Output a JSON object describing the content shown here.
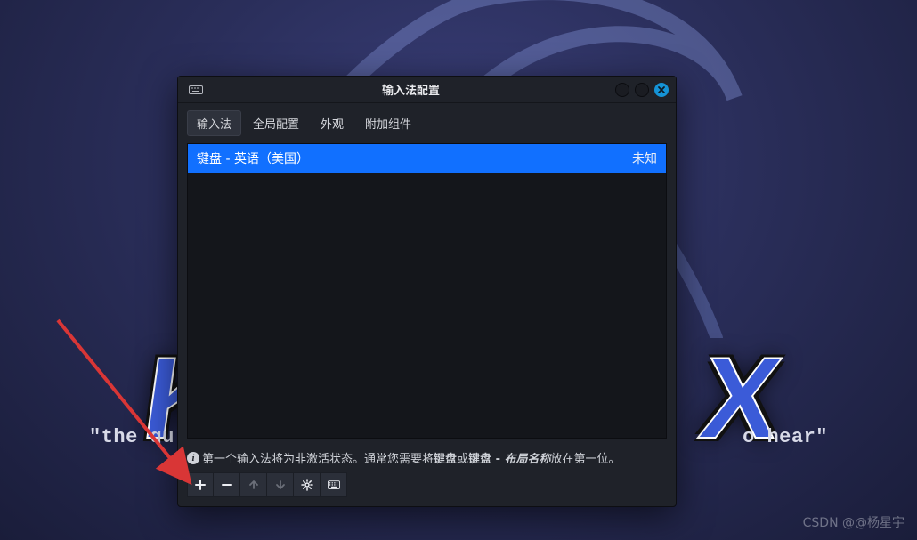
{
  "background": {
    "logo_left": "K",
    "logo_right": "X",
    "tagline_left": "\"the qu",
    "tagline_right": "o hear\""
  },
  "window": {
    "title": "输入法配置",
    "tabs": [
      {
        "label": "输入法",
        "active": true
      },
      {
        "label": "全局配置",
        "active": false
      },
      {
        "label": "外观",
        "active": false
      },
      {
        "label": "附加组件",
        "active": false
      }
    ],
    "list": {
      "selected": {
        "name": "键盘 - 英语（美国）",
        "status": "未知"
      }
    },
    "hint": {
      "p1": "第一个输入法将为非激活状态。通常您需要将",
      "b1": "键盘",
      "p2": "或",
      "b2": "键盘 - ",
      "i1": "布局名称",
      "p3": "放在第一位。"
    },
    "toolbar": {
      "add": "+",
      "remove": "−",
      "up": "↑",
      "down": "↓",
      "settings": "gear",
      "keyboard": "keyboard"
    }
  },
  "watermark": "CSDN @@杨星宇"
}
